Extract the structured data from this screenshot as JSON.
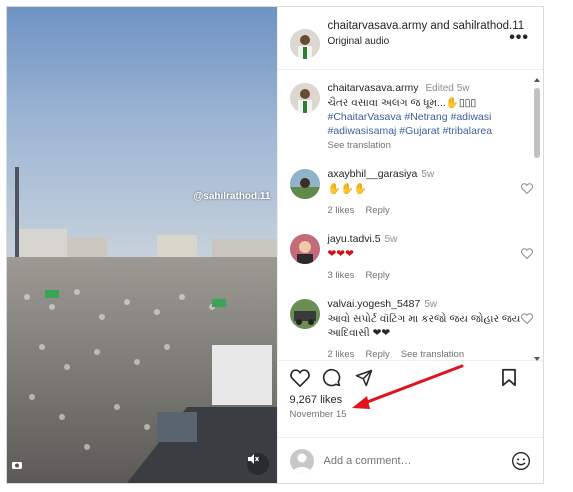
{
  "header": {
    "title": "chaitarvasava.army and sahilrathod.11",
    "subtitle": "Original audio",
    "more": "•••"
  },
  "media": {
    "watermark": "@sahilrathod.11"
  },
  "caption": {
    "user": "chaitarvasava.army",
    "edited": "Edited",
    "age": "5w",
    "text": "ચૈતર વસાવા અલગ જ ધૂમ...✋▯▯▯",
    "hashtags": [
      "#ChaitarVasava",
      "#Netrang",
      "#adiwasi",
      "#adiwasisamaj",
      "#Gujarat",
      "#tribalarea"
    ],
    "see_translation": "See translation"
  },
  "comments": [
    {
      "user": "axaybhil__garasiya",
      "age": "5w",
      "text": "✋✋✋",
      "likes": "2 likes",
      "reply": "Reply"
    },
    {
      "user": "jayu.tadvi.5",
      "age": "5w",
      "text": "❤❤❤",
      "likes": "3 likes",
      "reply": "Reply"
    },
    {
      "user": "valvai.yogesh_5487",
      "age": "5w",
      "text": "આવો સપોર્ટ વૉટિંગ મા કરજો જય જોહાર જય આદિવાસી ❤❤",
      "likes": "2 likes",
      "reply": "Reply",
      "see_translation": "See translation"
    }
  ],
  "post": {
    "likes": "9,267 likes",
    "date": "November 15"
  },
  "composer": {
    "placeholder": "Add a comment…"
  },
  "colors": {
    "hashtag": "#3e5f9a",
    "heart_red": "#d40e1b",
    "annotation_red": "#e0141e"
  }
}
